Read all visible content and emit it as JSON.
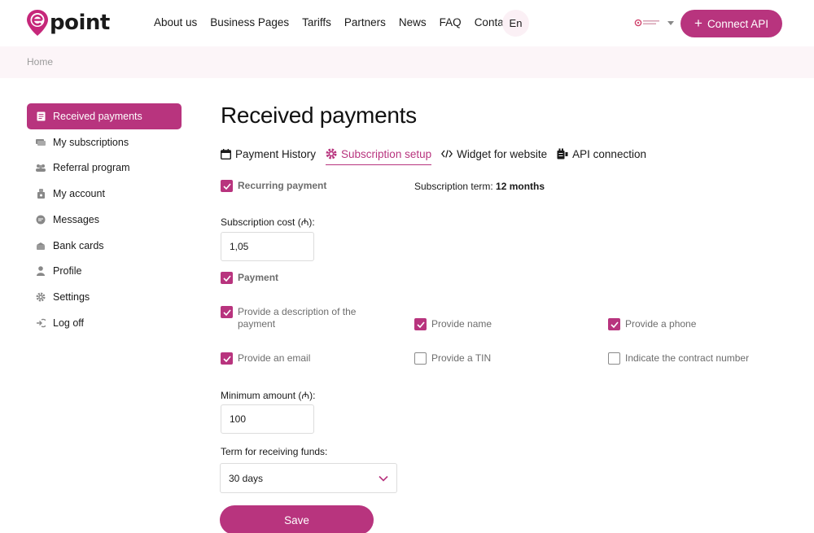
{
  "header": {
    "logo_text": "point",
    "nav": [
      "About us",
      "Business Pages",
      "Tariffs",
      "Partners",
      "News",
      "FAQ",
      "Contacts"
    ],
    "language": "En",
    "connect_label": "Connect API",
    "brand_color": "#b8347e"
  },
  "breadcrumb": {
    "home": "Home"
  },
  "sidebar": {
    "items": [
      {
        "label": "Received payments",
        "icon": "receipt-icon",
        "active": true
      },
      {
        "label": "My subscriptions",
        "icon": "card-stack-icon",
        "active": false
      },
      {
        "label": "Referral program",
        "icon": "people-icon",
        "active": false
      },
      {
        "label": "My account",
        "icon": "account-icon",
        "active": false
      },
      {
        "label": "Messages",
        "icon": "chat-icon",
        "active": false
      },
      {
        "label": "Bank cards",
        "icon": "bank-card-icon",
        "active": false
      },
      {
        "label": "Profile",
        "icon": "user-icon",
        "active": false
      },
      {
        "label": "Settings",
        "icon": "gear-icon",
        "active": false
      },
      {
        "label": "Log off",
        "icon": "logout-icon",
        "active": false
      }
    ]
  },
  "main": {
    "title": "Received payments",
    "tabs": [
      {
        "label": "Payment History",
        "icon": "calendar-icon",
        "active": false
      },
      {
        "label": "Subscription setup",
        "icon": "gear-icon",
        "active": true
      },
      {
        "label": "Widget for website",
        "icon": "code-icon",
        "active": false
      },
      {
        "label": "API connection",
        "icon": "api-icon",
        "active": false
      }
    ],
    "recurring_label": "Recurring payment",
    "recurring_checked": true,
    "term_label": "Subscription term:",
    "term_value": "12 months",
    "cost_label": "Subscription cost (₼):",
    "cost_value": "1,05",
    "payment_label": "Payment",
    "payment_checked": true,
    "options": [
      {
        "label": "Provide a description of the payment",
        "checked": true
      },
      {
        "label": "Provide name",
        "checked": true
      },
      {
        "label": "Provide a phone",
        "checked": true
      },
      {
        "label": "Provide an email",
        "checked": true
      },
      {
        "label": "Provide a TIN",
        "checked": false
      },
      {
        "label": "Indicate the contract number",
        "checked": false
      }
    ],
    "min_amount_label": "Minimum amount (₼):",
    "min_amount_value": "100",
    "term_funds_label": "Term for receiving funds:",
    "term_funds_value": "30 days",
    "save_label": "Save"
  }
}
